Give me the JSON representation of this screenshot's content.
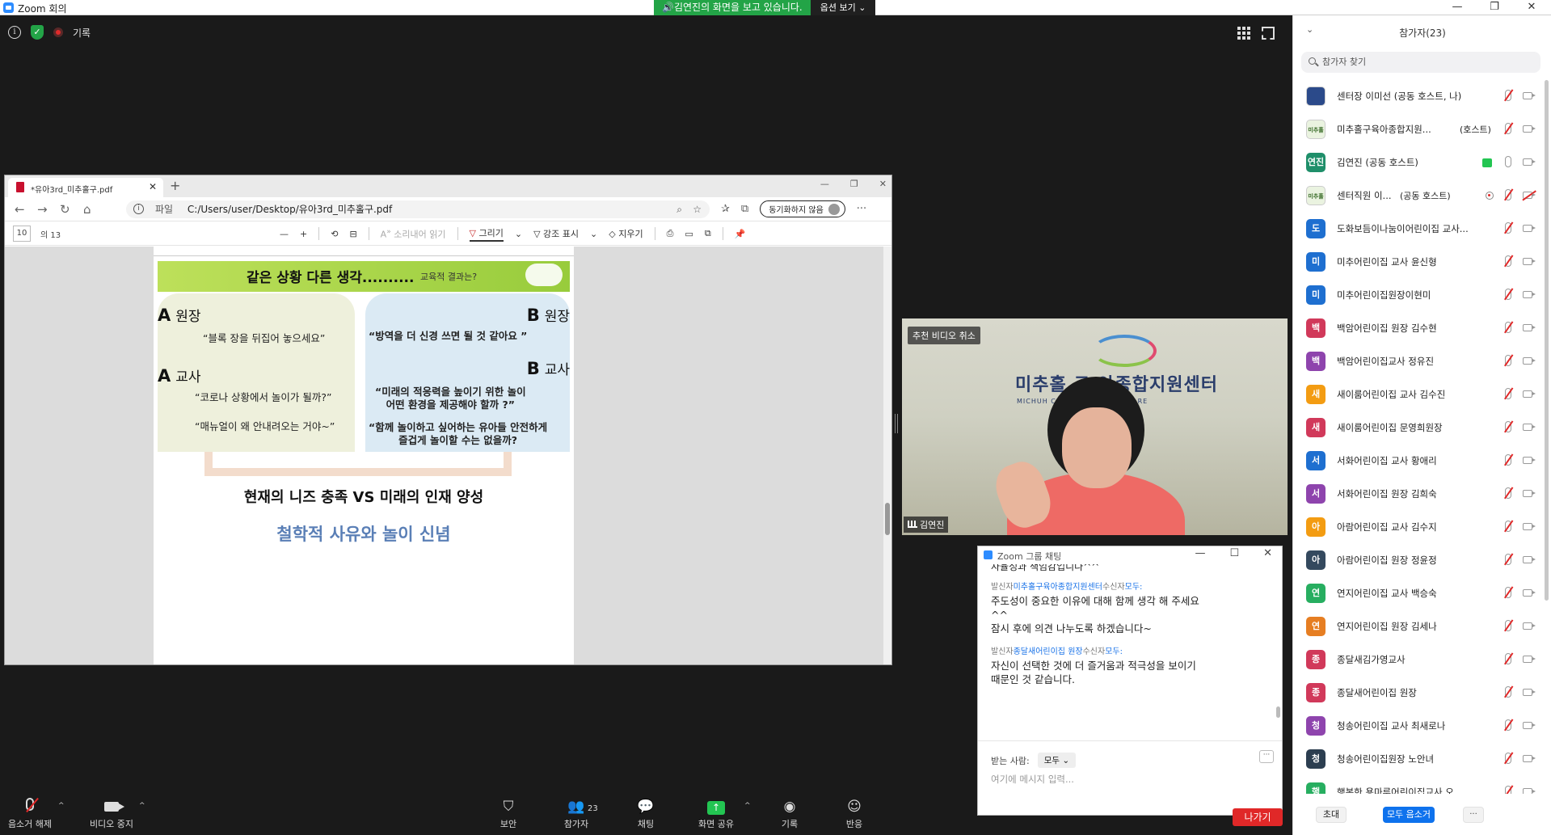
{
  "window": {
    "title": "Zoom 회의",
    "controls": [
      "—",
      "❐",
      "✕"
    ]
  },
  "share_banner": {
    "message": "김연진의 화면을 보고 있습니다.",
    "options_label": "옵션 보기"
  },
  "meeting": {
    "rec_label": "기록"
  },
  "browser": {
    "tab_title": "*유아3rd_미추홀구.pdf",
    "url_scheme": "파일",
    "url": "C:/Users/user/Desktop/유아3rd_미추홀구.pdf",
    "sync_label": "동기화하지 않음",
    "page_number": "10",
    "page_total": "의 13",
    "tools": {
      "read_aloud": "소리내어 읽기",
      "draw": "그리기",
      "highlight": "강조 표시",
      "erase": "지우기"
    }
  },
  "slide": {
    "title": "같은 상황 다른 생각..........",
    "subtitle": "교육적 결과는?",
    "a_director_letter": "A",
    "a_director_role": "원장",
    "a_director_quote": "“블록 장을 뒤집어 놓으세요”",
    "a_teacher_letter": "A",
    "a_teacher_role": "교사",
    "a_teacher_quote1": "“코로나 상황에서 놀이가 될까?”",
    "a_teacher_quote2": "“매뉴얼이 왜 안내려오는 거야~”",
    "b_director_letter": "B",
    "b_director_role": "원장",
    "b_director_quote": "“방역을 더 신경 쓰면 될 것 같아요 ”",
    "b_teacher_letter": "B",
    "b_teacher_role": "교사",
    "b_teacher_quote1a": "“미래의 적응력을 높이기 위한 놀이",
    "b_teacher_quote1b": "어떤 환경을 제공해야 할까 ?”",
    "b_teacher_quote2a": "“함께 놀이하고 싶어하는 유아들 안전하게",
    "b_teacher_quote2b": "즐겁게 놀이할 수는 없을까?",
    "summary": "현재의 니즈 충족 VS 미래의 인재 양성",
    "philosophy": "철학적 사유와 놀이 신념"
  },
  "video": {
    "unpin_label": "추천 비디오 취소",
    "sign_text": "미추홀 구 아종합지원센터",
    "sign_subtext": "MICHUH        CENTER FOR CHILDCARE",
    "speaker_name": "김연진"
  },
  "chat": {
    "title": "Zoom 그룹 채팅",
    "cut_text": "자율성과 책임감입니다^^",
    "messages": [
      {
        "from_label": "발신자",
        "from": "미추홀구육아종합지원센터",
        "to_label": "수신자",
        "to": "모두:",
        "lines": [
          "주도성이 중요한 이유에 대해 함께 생각 해 주세요",
          "^^",
          "잠시 후에 의견 나누도록 하겠습니다~"
        ]
      },
      {
        "from_label": "발신자",
        "from": "종달새어린이집 원장",
        "to_label": "수신자",
        "to": "모두:",
        "lines": [
          "자신이 선택한 것에 더 즐거움과 적극성을 보이기",
          "때문인 것 같습니다."
        ]
      }
    ],
    "recipient_label": "받는 사람:",
    "recipient_value": "모두",
    "input_placeholder": "여기에 메시지 입력..."
  },
  "leave_label": "나가기",
  "toolbar": {
    "unmute": "음소거 해제",
    "stop_video": "비디오 중지",
    "security": "보안",
    "participants": "참가자",
    "participants_count": "23",
    "chat": "채팅",
    "share_screen": "화면 공유",
    "record": "기록",
    "reactions": "반응"
  },
  "panel": {
    "title": "참가자(23)",
    "search_placeholder": "참가자 찾기",
    "invite": "초대",
    "mute_all": "모두 음소거",
    "more": "...",
    "participants": [
      {
        "name": "센터장 이미선 (공동 호스트, 나)",
        "avatar_text": "",
        "color": "#2b4a8a",
        "img": true,
        "badge": ""
      },
      {
        "name": "미추홀구육아종합지원...",
        "avatar_text": "미추홀",
        "color": "#6aa84f",
        "img": true,
        "badge": "(호스트)"
      },
      {
        "name": "김연진 (공동 호스트)",
        "avatar_text": "연진",
        "color": "#1f8f6a",
        "img": false,
        "badge": ""
      },
      {
        "name": "센터직원 이...",
        "avatar_text": "미추홀",
        "color": "#6aa84f",
        "img": true,
        "badge": "(공동 호스트)"
      },
      {
        "name": "도화보듬이나눔이어린이집 교사...",
        "avatar_text": "도",
        "color": "#1e6fd0",
        "img": false,
        "badge": ""
      },
      {
        "name": "미추어린이집 교사 윤신형",
        "avatar_text": "미",
        "color": "#1e6fd0",
        "img": false,
        "badge": ""
      },
      {
        "name": "미추어린이집원장이현미",
        "avatar_text": "미",
        "color": "#1e6fd0",
        "img": false,
        "badge": ""
      },
      {
        "name": "백암어린이집 원장 김수현",
        "avatar_text": "백",
        "color": "#d1395a",
        "img": false,
        "badge": ""
      },
      {
        "name": "백암어린이집교사 정유진",
        "avatar_text": "백",
        "color": "#8e44ad",
        "img": false,
        "badge": ""
      },
      {
        "name": "새이룸어린이집 교사 김수진",
        "avatar_text": "새",
        "color": "#f39c12",
        "img": false,
        "badge": ""
      },
      {
        "name": "새이룸어린이집 문영희원장",
        "avatar_text": "새",
        "color": "#d1395a",
        "img": false,
        "badge": ""
      },
      {
        "name": "서화어린이집 교사 황애리",
        "avatar_text": "서",
        "color": "#1e6fd0",
        "img": false,
        "badge": ""
      },
      {
        "name": "서화어린이집 원장 김희숙",
        "avatar_text": "서",
        "color": "#8e44ad",
        "img": false,
        "badge": ""
      },
      {
        "name": "아람어린이집 교사 김수지",
        "avatar_text": "아",
        "color": "#f39c12",
        "img": false,
        "badge": ""
      },
      {
        "name": "아람어린이집 원장 정윤정",
        "avatar_text": "아",
        "color": "#34495e",
        "img": false,
        "badge": ""
      },
      {
        "name": "연지어린이집 교사 백승숙",
        "avatar_text": "연",
        "color": "#27ae60",
        "img": false,
        "badge": ""
      },
      {
        "name": "연지어린이집 원장 김세나",
        "avatar_text": "연",
        "color": "#e67e22",
        "img": false,
        "badge": ""
      },
      {
        "name": "종달새김가영교사",
        "avatar_text": "종",
        "color": "#d1395a",
        "img": false,
        "badge": ""
      },
      {
        "name": "종달새어린이집 원장",
        "avatar_text": "종",
        "color": "#d1395a",
        "img": false,
        "badge": ""
      },
      {
        "name": "청송어린이집 교사 최새로나",
        "avatar_text": "청",
        "color": "#8e44ad",
        "img": false,
        "badge": ""
      },
      {
        "name": "청송어린이집원장 노안녀",
        "avatar_text": "청",
        "color": "#2c3e50",
        "img": false,
        "badge": ""
      },
      {
        "name": "행복한 용마루어린이집교사 오...",
        "avatar_text": "행",
        "color": "#27ae60",
        "img": false,
        "badge": ""
      }
    ]
  }
}
